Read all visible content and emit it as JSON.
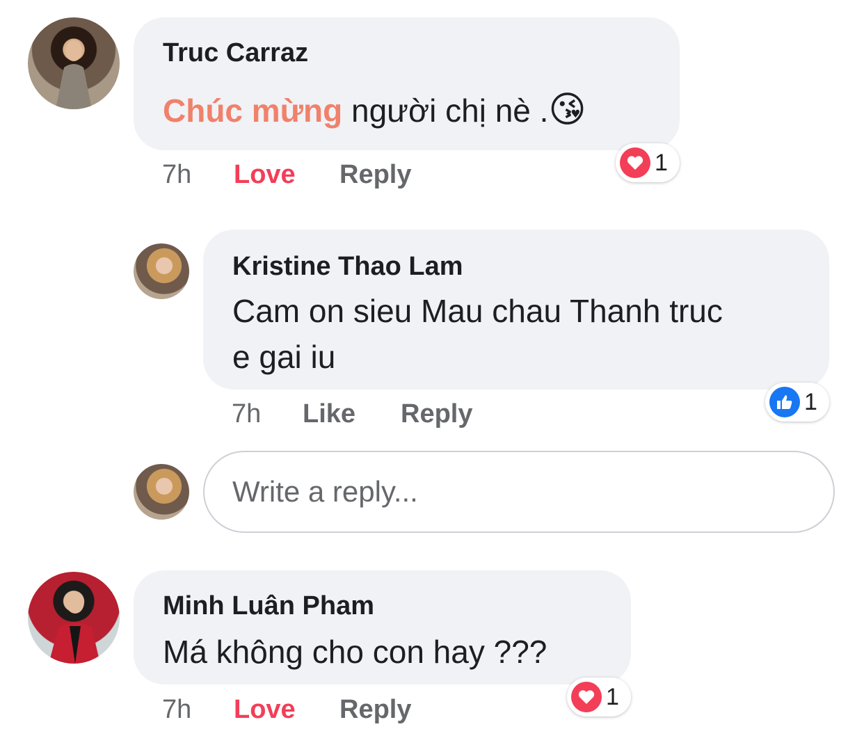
{
  "comments": [
    {
      "author": "Truc Carraz",
      "text_highlight": "Chúc mừng",
      "text_rest": " người chị nè .",
      "emoji": "😘",
      "time": "7h",
      "action_reaction": "Love",
      "action_reply": "Reply",
      "reaction_icon": "heart-icon",
      "reaction_count": "1"
    },
    {
      "author": "Kristine Thao Lam",
      "text_line1": "Cam on sieu Mau chau Thanh truc",
      "text_line2": "e gai iu",
      "time": "7h",
      "action_reaction": "Like",
      "action_reply": "Reply",
      "reaction_icon": "thumbs-up-icon",
      "reaction_count": "1"
    },
    {
      "author": "Minh Luân Pham",
      "text": "Má không cho con hay ???",
      "time": "7h",
      "action_reaction": "Love",
      "action_reply": "Reply",
      "reaction_icon": "heart-icon",
      "reaction_count": "1"
    }
  ],
  "reply_input": {
    "placeholder": "Write a reply..."
  },
  "colors": {
    "love": "#f33e58",
    "like": "#1877f2",
    "bubble": "#f0f2f5",
    "highlight": "#f0816b"
  }
}
